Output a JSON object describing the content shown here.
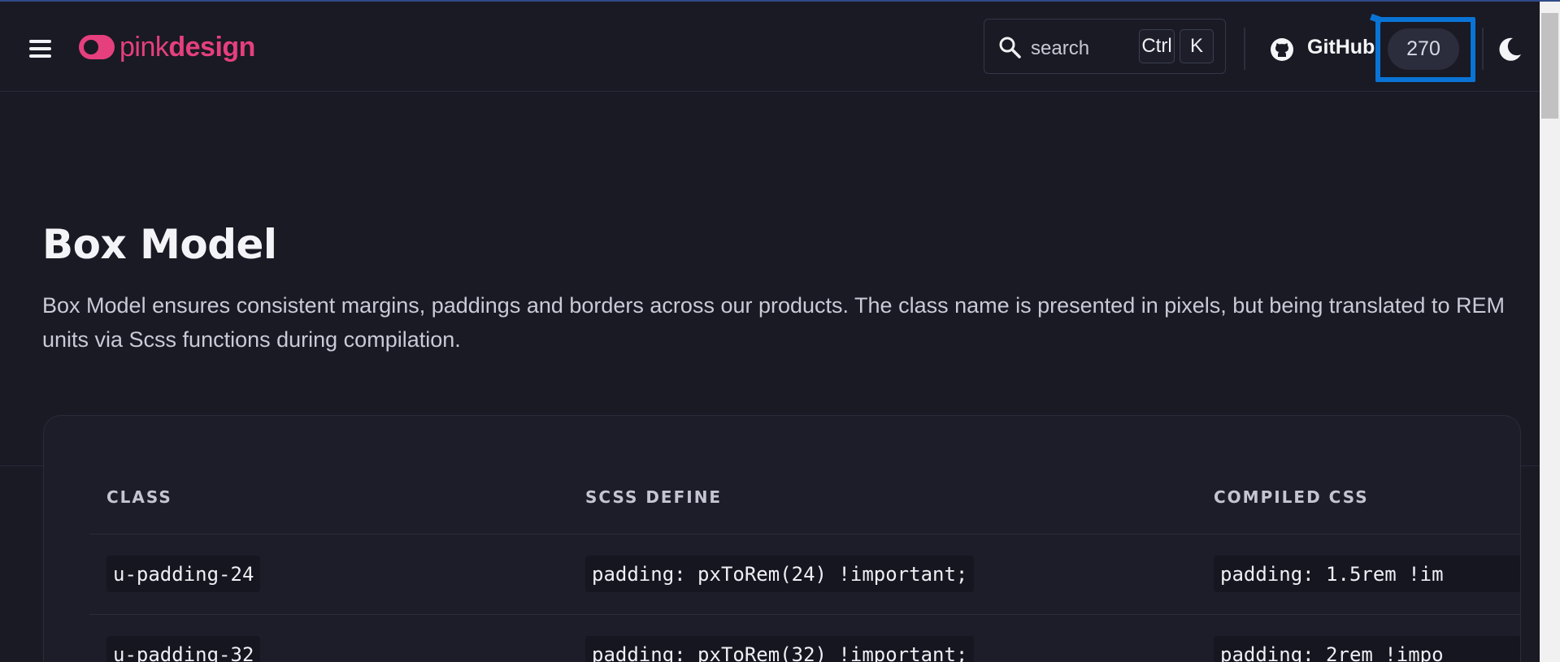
{
  "header": {
    "logo": {
      "light": "pink",
      "bold": "design"
    },
    "search": {
      "placeholder": "search",
      "shortcut": [
        "Ctrl",
        "K"
      ]
    },
    "github": {
      "label": "GitHub",
      "stars": "270"
    }
  },
  "main": {
    "title": "Box Model",
    "description": "Box Model ensures consistent margins, paddings and borders across our products. The class name is presented in pixels, but being translated to REM units via Scss functions during compilation."
  },
  "table": {
    "headers": [
      "CLASS",
      "SCSS DEFINE",
      "COMPILED CSS"
    ],
    "rows": [
      {
        "class": "u-padding-24",
        "scss": "padding: pxToRem(24) !important;",
        "css": "padding: 1.5rem !im"
      },
      {
        "class": "u-padding-32",
        "scss": "padding: pxToRem(32) !important;",
        "css": "padding: 2rem !impo"
      }
    ]
  },
  "colors": {
    "accent": "#e63f7e",
    "background": "#191a24",
    "highlight": "#0a74d6"
  },
  "icons": [
    "menu-icon",
    "logo-icon",
    "search-icon",
    "github-icon",
    "moon-icon"
  ]
}
